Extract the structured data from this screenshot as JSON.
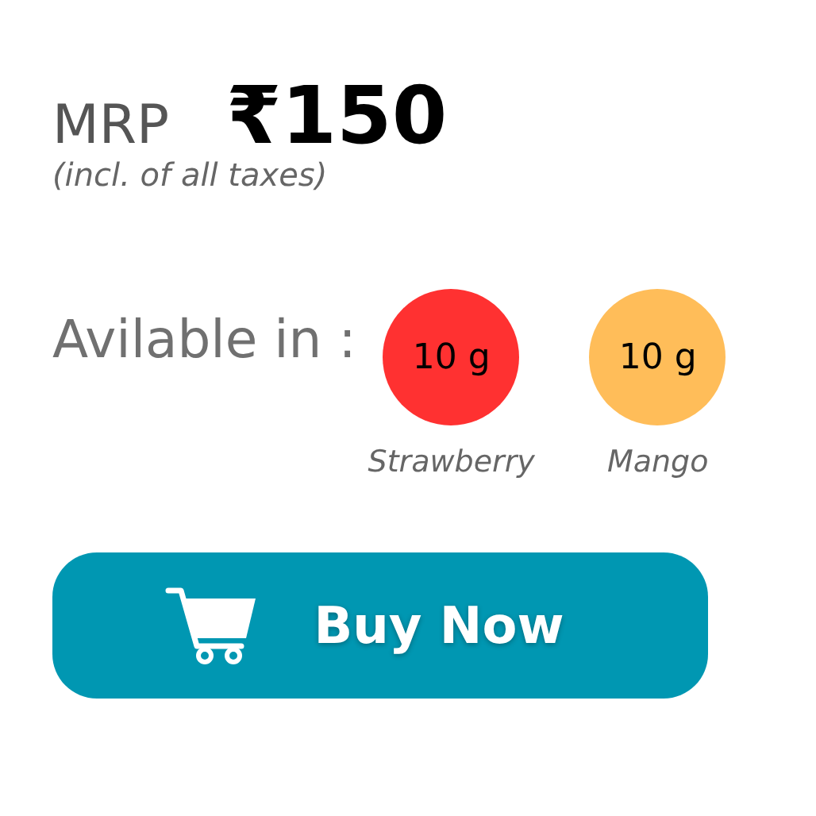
{
  "price": {
    "label": "MRP",
    "amount": "₹150",
    "note": "(incl. of all taxes)"
  },
  "availability": {
    "label": "Avilable in :",
    "variants": [
      {
        "size": "10 g",
        "name": "Strawberry",
        "color": "#ff3131"
      },
      {
        "size": "10 g",
        "name": "Mango",
        "color": "#ffbd59"
      }
    ]
  },
  "button": {
    "label": "Buy Now"
  }
}
